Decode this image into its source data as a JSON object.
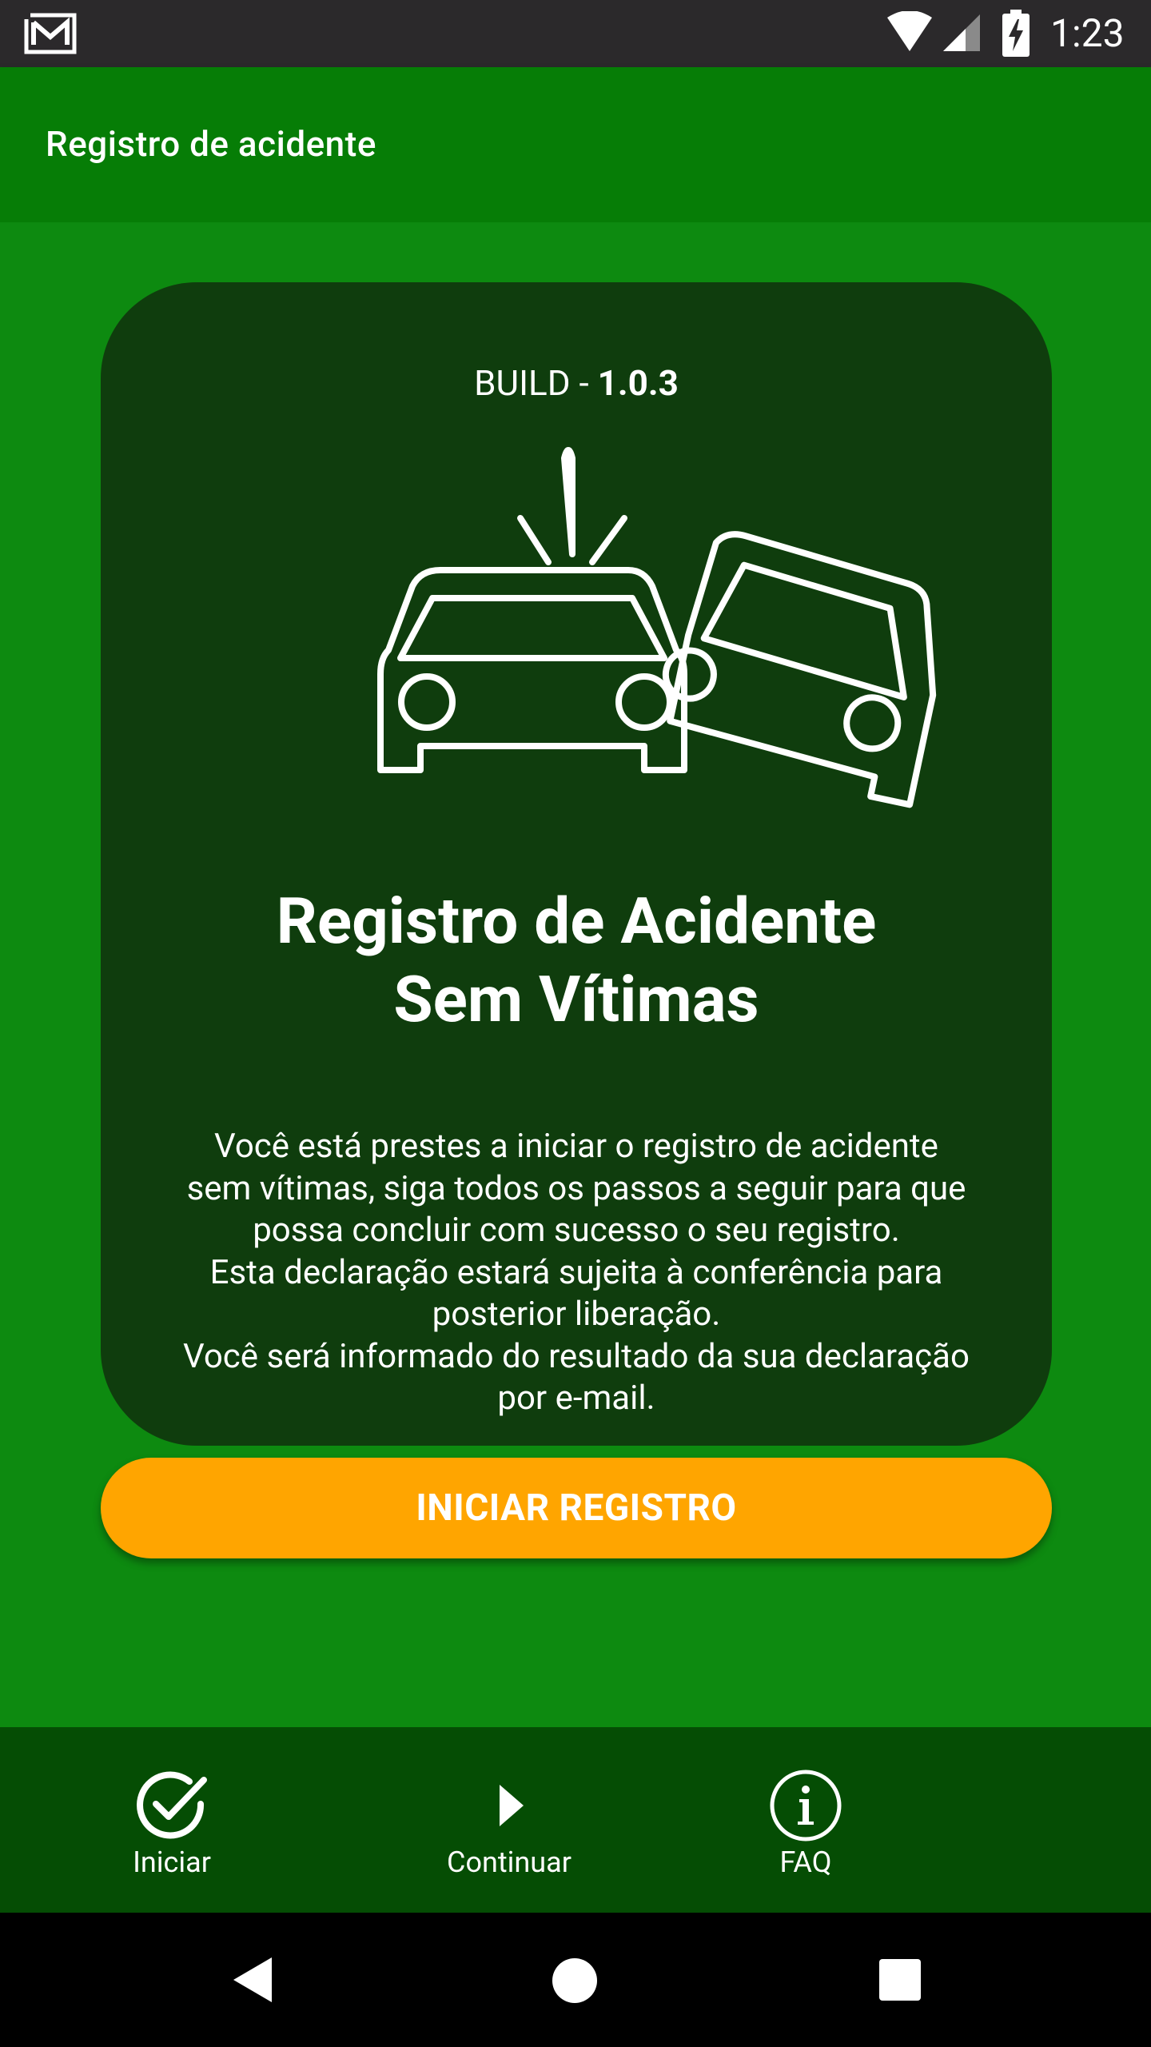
{
  "status_bar": {
    "time": "1:23",
    "icons": [
      "gmail-icon",
      "wifi-icon",
      "signal-icon",
      "battery-charging-icon"
    ]
  },
  "app_bar": {
    "title": "Registro de acidente"
  },
  "card": {
    "build_label": "BUILD - ",
    "build_version": "1.0.3",
    "illustration": "car-crash-icon",
    "heading_line1": "Registro de Acidente",
    "heading_line2": "Sem Vítimas",
    "description_lines": [
      "Você está prestes a iniciar o registro de acidente",
      "sem vítimas, siga todos os passos a seguir para que",
      "possa concluir com sucesso o seu registro.",
      "Esta declaração estará sujeita à conferência para",
      "posterior liberação.",
      "Você será informado do resultado da sua declaração",
      "por e-mail."
    ]
  },
  "start_button": {
    "label": "INICIAR REGISTRO"
  },
  "bottom_nav": {
    "items": [
      {
        "label": "Iniciar",
        "icon": "check-circle-icon"
      },
      {
        "label": "Continuar",
        "icon": "play-arrow-icon"
      },
      {
        "label": "FAQ",
        "icon": "info-circle-icon"
      }
    ]
  },
  "system_nav": {
    "icons": [
      "back-icon",
      "home-icon",
      "recents-icon"
    ]
  },
  "colors": {
    "status_bar": "#2b292b",
    "app_bar": "#067d06",
    "background": "#0d8a10",
    "card": "#0f3d0d",
    "button": "#ffa500",
    "bottom_nav": "#054d04"
  }
}
